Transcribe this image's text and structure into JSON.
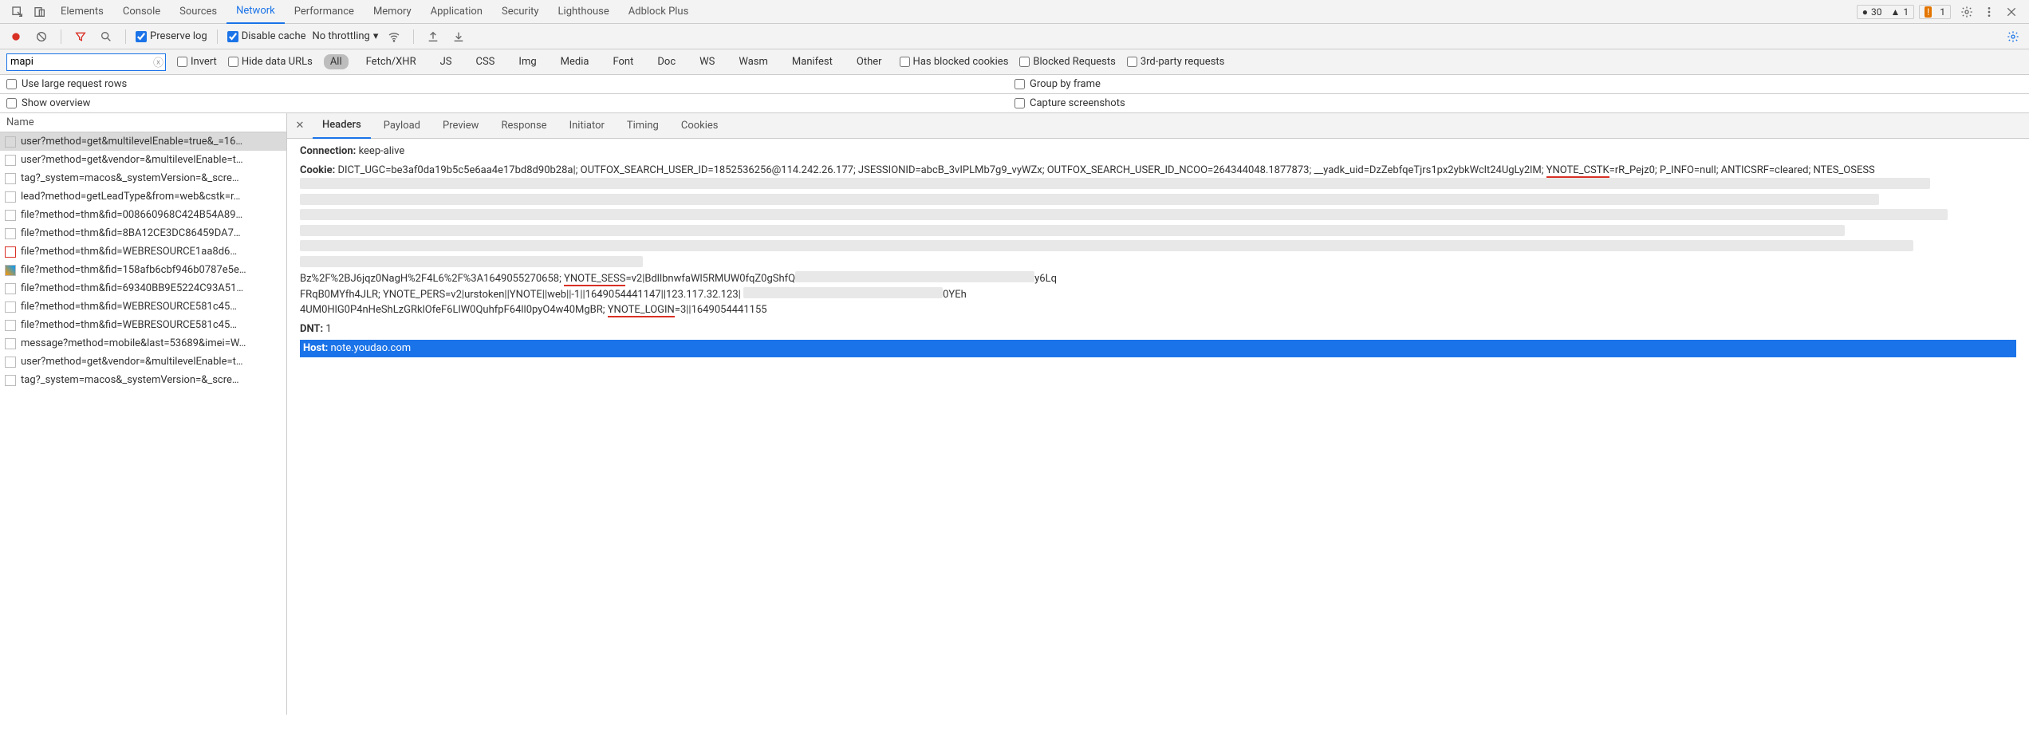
{
  "tabs": {
    "elements": "Elements",
    "console": "Console",
    "sources": "Sources",
    "network": "Network",
    "performance": "Performance",
    "memory": "Memory",
    "application": "Application",
    "security": "Security",
    "lighthouse": "Lighthouse",
    "adblock": "Adblock Plus"
  },
  "badges": {
    "errors_dot": "●",
    "errors_count": "30",
    "warnings_tri": "▲",
    "warnings_count": "1",
    "issues_count": "1",
    "issues_icon": "!"
  },
  "toolbar": {
    "preserve_log": "Preserve log",
    "disable_cache": "Disable cache",
    "throttling": "No throttling"
  },
  "filter": {
    "value": "mapi",
    "invert": "Invert",
    "hide_data": "Hide data URLs",
    "types": [
      "All",
      "Fetch/XHR",
      "JS",
      "CSS",
      "Img",
      "Media",
      "Font",
      "Doc",
      "WS",
      "Wasm",
      "Manifest",
      "Other"
    ],
    "blocked_cookies": "Has blocked cookies",
    "blocked_requests": "Blocked Requests",
    "third_party": "3rd-party requests"
  },
  "options": {
    "large_rows": "Use large request rows",
    "group_frame": "Group by frame",
    "show_overview": "Show overview",
    "capture_ss": "Capture screenshots"
  },
  "request_list": {
    "header": "Name",
    "items": [
      "user?method=get&multilevelEnable=true&_=16…",
      "user?method=get&vendor=&multilevelEnable=t…",
      "tag?_system=macos&_systemVersion=&_scre…",
      "lead?method=getLeadType&from=web&cstk=r…",
      "file?method=thm&fid=008660968C424B54A89…",
      "file?method=thm&fid=8BA12CE3DC86459DA7…",
      "file?method=thm&fid=WEBRESOURCE1aa8d6…",
      "file?method=thm&fid=158afb6cbf946b0787e5e…",
      "file?method=thm&fid=69340BB9E5224C93A51…",
      "file?method=thm&fid=WEBRESOURCE581c45…",
      "file?method=thm&fid=WEBRESOURCE581c45…",
      "message?method=mobile&last=53689&imei=W…",
      "user?method=get&vendor=&multilevelEnable=t…",
      "tag?_system=macos&_systemVersion=&_scre…"
    ]
  },
  "detail": {
    "tabs": [
      "Headers",
      "Payload",
      "Preview",
      "Response",
      "Initiator",
      "Timing",
      "Cookies"
    ],
    "headers": {
      "connection": {
        "name": "Connection:",
        "value": "keep-alive"
      },
      "cookie_name": "Cookie:",
      "cookie_pre": "DICT_UGC=be3af0da19b5c5e6aa4e17bd8d90b28a|; OUTFOX_SEARCH_USER_ID=1852536256@114.242.26.177; JSESSIONID=abcB_3vIPLMb7g9_vyWZx; OUTFOX_SEARCH_USER_ID_NCOO=264344048.1877873; __yadk_uid=DzZebfqeTjrs1px2ybkWclt24UgLy2lM; ",
      "ynote_cstk": "YNOTE_CSTK",
      "cookie_mid1": "=rR_Pejz0; P_INFO=null; ANTICSRF=cleared; NTES_OSESS",
      "cookie_mid2": "Bz%2F%2BJ6jqz0NagH%2F4L6%2F%3A1649055270658; ",
      "ynote_sess": "YNOTE_SESS",
      "cookie_mid3": "=v2|BdllbnwfaWl5RMUW0fqZ0gShfQ",
      "cookie_mid4": "FRqB0MYfh4JLR; YNOTE_PERS=v2|urstoken||YNOTE||web||-1||1649054441147||123.117.32.123|",
      "cookie_mid5": "4UM0HlG0P4nHeShLzGRklOfeF6LlW0QuhfpF64ll0pyO4w40MgBR; ",
      "ynote_login": "YNOTE_LOGIN",
      "cookie_end": "=3||1649054441155",
      "cookie_tail1": "y6Lq",
      "cookie_tail2": "0YEh",
      "dnt": {
        "name": "DNT:",
        "value": "1"
      },
      "host": {
        "name": "Host:",
        "value": "note.youdao.com"
      }
    }
  }
}
